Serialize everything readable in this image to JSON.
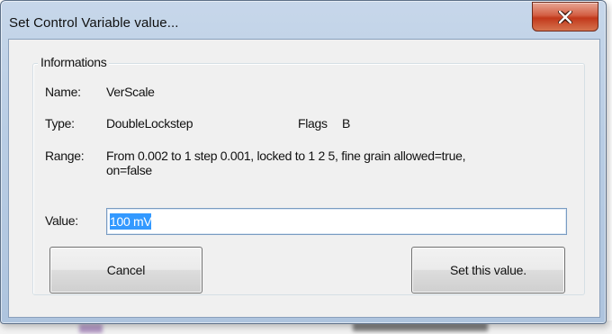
{
  "window": {
    "title": "Set Control Variable value...",
    "close_icon": "close-icon"
  },
  "group": {
    "legend": "Informations"
  },
  "info": {
    "name_label": "Name:",
    "name_value": "VerScale",
    "type_label": "Type:",
    "type_value": "DoubleLockstep",
    "flags_label": "Flags",
    "flags_value": "B",
    "range_label": "Range:",
    "range_line1": "From 0.002 to 1 step 0.001, locked to 1 2 5, fine grain allowed=true,",
    "range_line2": "on=false"
  },
  "value": {
    "label": "Value:",
    "input_value": "100 mV"
  },
  "buttons": {
    "cancel": "Cancel",
    "set": "Set this value."
  },
  "colors": {
    "selection": "#3399ff",
    "close_button": "#c7462a"
  }
}
